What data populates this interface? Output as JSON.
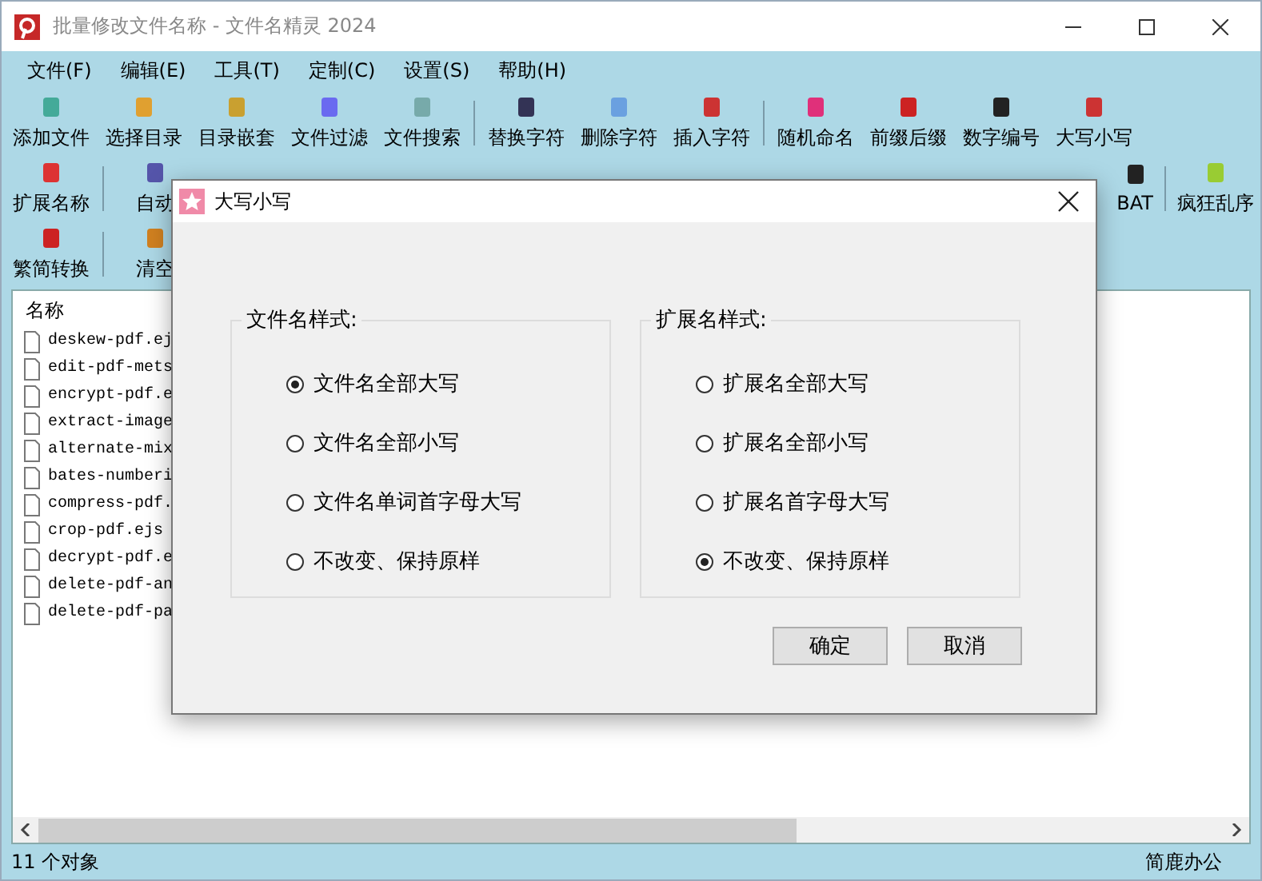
{
  "window": {
    "title": "批量修改文件名称 - 文件名精灵 2024"
  },
  "menu": [
    "文件(F)",
    "编辑(E)",
    "工具(T)",
    "定制(C)",
    "设置(S)",
    "帮助(H)"
  ],
  "toolbar_rows": [
    {
      "left": [
        {
          "kind": "button",
          "label": "添加文件"
        },
        {
          "kind": "button",
          "label": "选择目录"
        },
        {
          "kind": "button",
          "label": "目录嵌套"
        },
        {
          "kind": "button",
          "label": "文件过滤"
        },
        {
          "kind": "button",
          "label": "文件搜索"
        },
        {
          "kind": "separator"
        },
        {
          "kind": "button",
          "label": "替换字符"
        },
        {
          "kind": "button",
          "label": "删除字符"
        },
        {
          "kind": "button",
          "label": "插入字符"
        },
        {
          "kind": "separator"
        },
        {
          "kind": "button",
          "label": "随机命名"
        },
        {
          "kind": "button",
          "label": "前缀后缀"
        },
        {
          "kind": "button",
          "label": "数字编号"
        },
        {
          "kind": "button",
          "label": "大写小写"
        }
      ]
    },
    {
      "left": [
        {
          "kind": "button",
          "label": "扩展名称"
        },
        {
          "kind": "separator"
        },
        {
          "kind": "button",
          "label": "自动"
        }
      ],
      "right": [
        {
          "kind": "button",
          "label": "BAT"
        },
        {
          "kind": "separator"
        },
        {
          "kind": "button",
          "label": "疯狂乱序"
        }
      ]
    },
    {
      "left": [
        {
          "kind": "button",
          "label": "繁简转换"
        },
        {
          "kind": "separator"
        },
        {
          "kind": "button",
          "label": "清空"
        }
      ]
    }
  ],
  "file_list": {
    "column": "名称",
    "files": [
      "deskew-pdf.ej",
      "edit-pdf-mets",
      "encrypt-pdf.e",
      "extract-image",
      "alternate-mix",
      "bates-numberi",
      "compress-pdf.",
      "crop-pdf.ejs",
      "decrypt-pdf.e",
      "delete-pdf-an",
      "delete-pdf-pa"
    ]
  },
  "status_bar": {
    "left": "11 个对象",
    "right": "简鹿办公"
  },
  "dialog": {
    "title": "大写小写",
    "groups": [
      {
        "title": "文件名样式:",
        "options": [
          {
            "label": "文件名全部大写",
            "selected": true
          },
          {
            "label": "文件名全部小写",
            "selected": false
          },
          {
            "label": "文件名单词首字母大写",
            "selected": false
          },
          {
            "label": "不改变、保持原样",
            "selected": false
          }
        ]
      },
      {
        "title": "扩展名样式:",
        "options": [
          {
            "label": "扩展名全部大写",
            "selected": false
          },
          {
            "label": "扩展名全部小写",
            "selected": false
          },
          {
            "label": "扩展名首字母大写",
            "selected": false
          },
          {
            "label": "不改变、保持原样",
            "selected": true
          }
        ]
      }
    ],
    "buttons": [
      "确定",
      "取消"
    ]
  }
}
